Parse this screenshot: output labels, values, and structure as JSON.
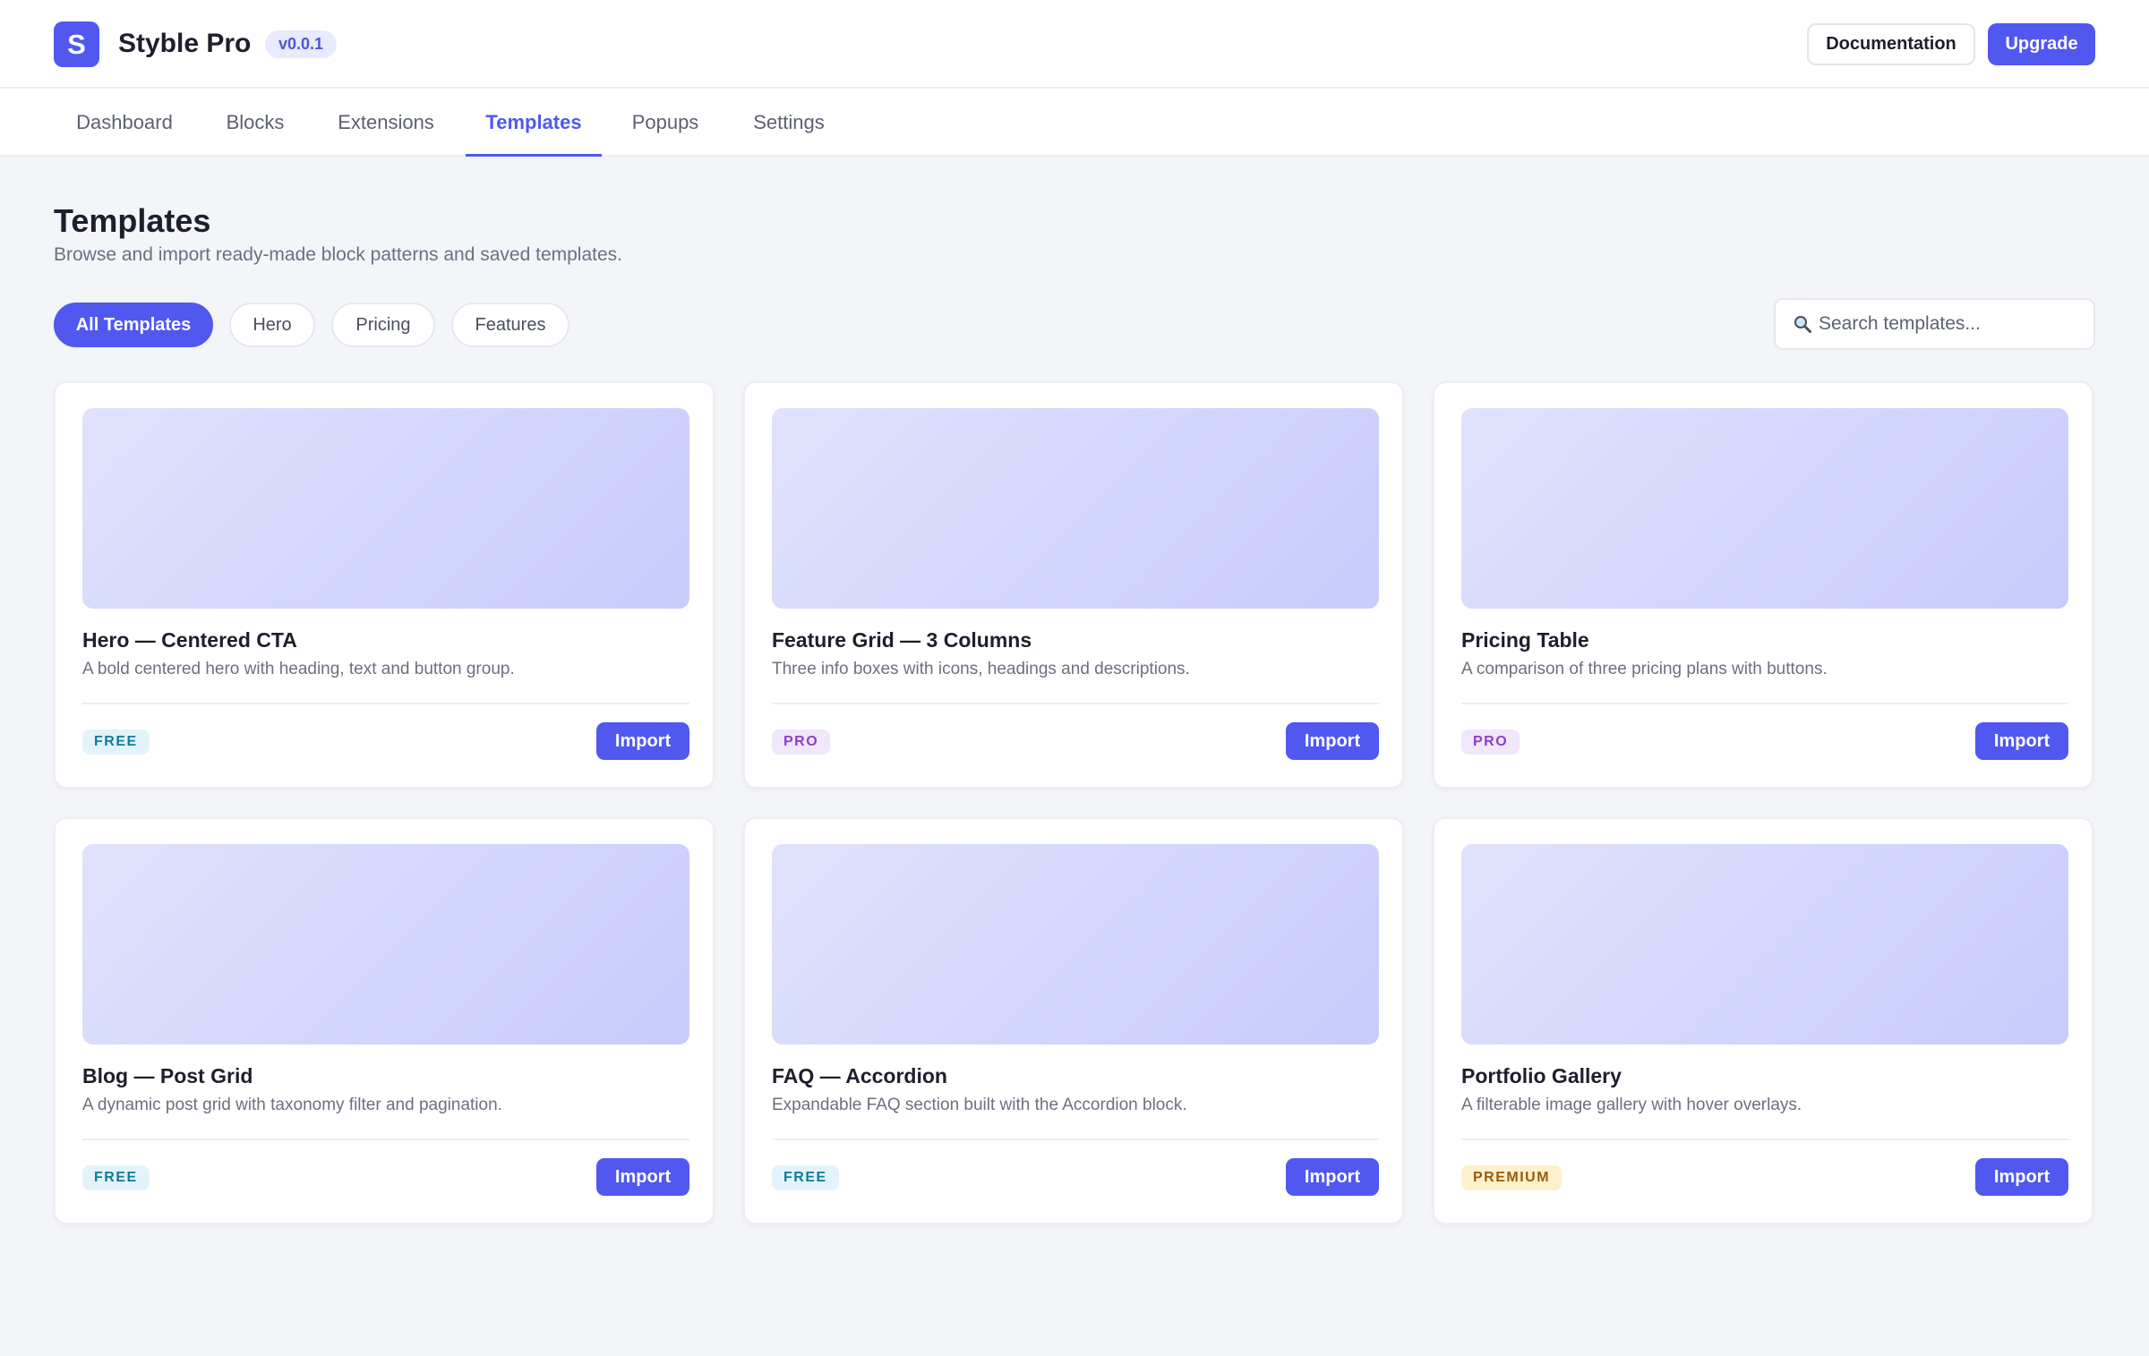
{
  "app": {
    "logo_letter": "S",
    "name": "Styble Pro",
    "version": "v0.0.1",
    "documentation_label": "Documentation",
    "upgrade_label": "Upgrade",
    "accent_color": "#5058f0"
  },
  "tabs": [
    {
      "label": "Dashboard",
      "active": false
    },
    {
      "label": "Blocks",
      "active": false
    },
    {
      "label": "Extensions",
      "active": false
    },
    {
      "label": "Templates",
      "active": true
    },
    {
      "label": "Popups",
      "active": false
    },
    {
      "label": "Settings",
      "active": false
    }
  ],
  "page": {
    "title": "Templates",
    "subtitle": "Browse and import ready-made block patterns and saved templates."
  },
  "filters": [
    {
      "label": "All Templates",
      "active": true
    },
    {
      "label": "Hero",
      "active": false
    },
    {
      "label": "Pricing",
      "active": false
    },
    {
      "label": "Features",
      "active": false
    }
  ],
  "search": {
    "icon": "magnifier-icon",
    "placeholder": "Search templates...",
    "value": ""
  },
  "import_label": "Import",
  "templates": [
    {
      "title": "Hero — Centered CTA",
      "description": "A bold centered hero with heading, text and button group.",
      "badge": "FREE",
      "tier": "free"
    },
    {
      "title": "Feature Grid — 3 Columns",
      "description": "Three info boxes with icons, headings and descriptions.",
      "badge": "PRO",
      "tier": "pro"
    },
    {
      "title": "Pricing Table",
      "description": "A comparison of three pricing plans with buttons.",
      "badge": "PRO",
      "tier": "pro"
    },
    {
      "title": "Blog — Post Grid",
      "description": "A dynamic post grid with taxonomy filter and pagination.",
      "badge": "FREE",
      "tier": "free"
    },
    {
      "title": "FAQ — Accordion",
      "description": "Expandable FAQ section built with the Accordion block.",
      "badge": "FREE",
      "tier": "free"
    },
    {
      "title": "Portfolio Gallery",
      "description": "A filterable image gallery with hover overlays.",
      "badge": "PREMIUM",
      "tier": "premium"
    }
  ]
}
